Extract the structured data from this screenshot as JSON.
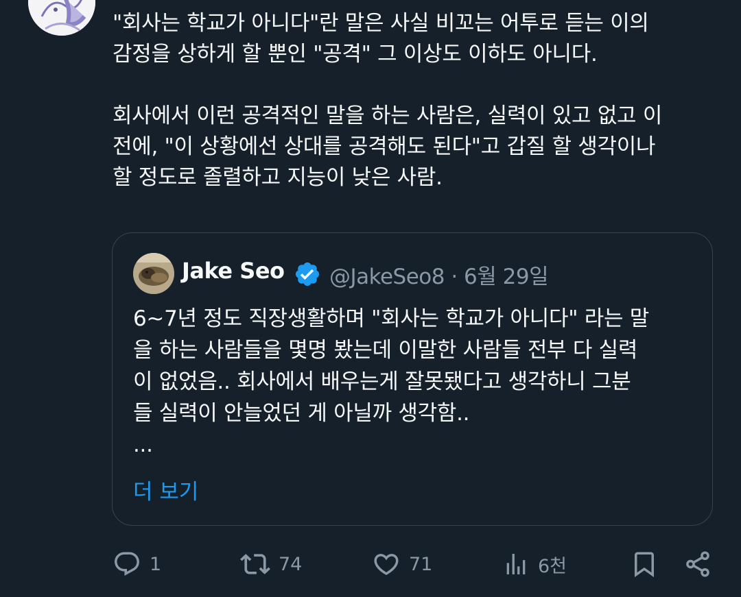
{
  "tweet": {
    "text": "\"회사는 학교가 아니다\"란 말은 사실 비꼬는 어투로 듣는 이의\n감정을 상하게 할 뿐인 \"공격\" 그 이상도 이하도 아니다.\n\n회사에서 이런 공격적인 말을 하는 사람은, 실력이 있고 없고 이\n전에, \"이 상황에선 상대를 공격해도 된다\"고 갑질 할 생각이나\n할 정도로 졸렬하고 지능이 낮은 사람."
  },
  "quote": {
    "name": "Jake Seo",
    "handle_date": "@JakeSeo8 · 6월 29일",
    "text": "6~7년 정도 직장생활하며 \"회사는 학교가 아니다\" 라는 말\n을 하는 사람들을 몇명 봤는데 이말한 사람들 전부 다 실력\n이 없었음.. 회사에서 배우는게 잘못됐다고 생각하니 그분\n들 실력이 안늘었던 게 아닐까 생각함..\n...",
    "show_more": "더 보기"
  },
  "actions": {
    "reply_count": "1",
    "retweet_count": "74",
    "like_count": "71",
    "views_count": "6천"
  },
  "colors": {
    "background": "#15202b",
    "text": "#f7f9f9",
    "muted": "#8b98a5",
    "accent": "#1d9bf0",
    "border": "#38444d"
  },
  "icons": [
    "avatar",
    "verified-badge-icon",
    "reply-icon",
    "retweet-icon",
    "like-icon",
    "views-icon",
    "bookmark-icon",
    "share-icon"
  ]
}
